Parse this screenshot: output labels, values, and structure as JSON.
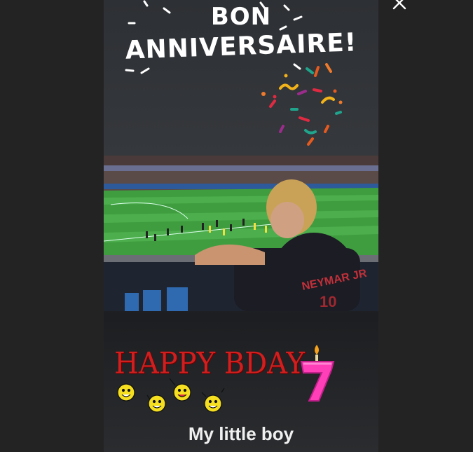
{
  "story": {
    "title_line1": "BON",
    "title_line2": "ANNIVERSAIRE!",
    "bday_sticker": "HAPPY BDAY",
    "candle_number": "7",
    "caption": "My little boy",
    "photo": "photo-of-boy-watching-football-match-in-stadium",
    "jersey_text": "NEYMAR JR",
    "jersey_number": "10"
  },
  "icons": {
    "close": "close-icon",
    "confetti": "confetti-icon",
    "smiley": "smiley-icon",
    "candle": "birthday-candle-icon"
  },
  "colors": {
    "background": "#232323",
    "title": "#ffffff",
    "bday_red": "#d11e1e",
    "candle_pink": "#ff3fb8",
    "smiley_yellow": "#f5df20",
    "pitch_green": "#3f9d3f"
  }
}
